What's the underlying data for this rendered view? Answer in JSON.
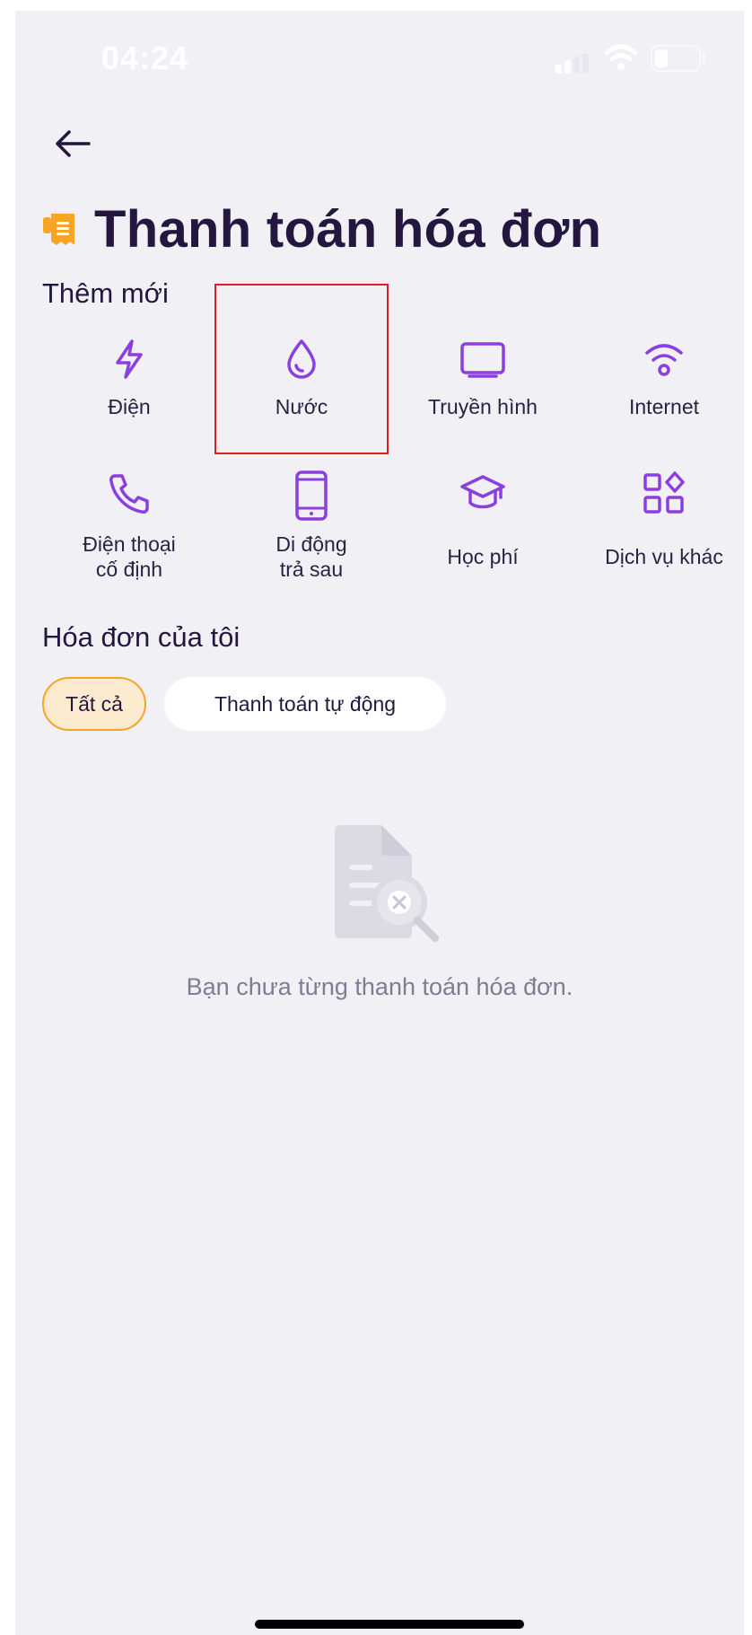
{
  "status_bar": {
    "time": "04:24"
  },
  "header": {
    "title": "Thanh toán hóa đơn",
    "back_icon": "arrow-left-icon"
  },
  "add_new": {
    "section_title": "Thêm mới",
    "services": [
      {
        "label": "Điện",
        "icon": "lightning-icon"
      },
      {
        "label": "Nước",
        "icon": "water-drop-icon"
      },
      {
        "label": "Truyền hình",
        "icon": "tv-icon"
      },
      {
        "label": "Internet",
        "icon": "wifi-icon"
      },
      {
        "label_line1": "Điện thoại",
        "label_line2": "cố định",
        "icon": "phone-icon"
      },
      {
        "label_line1": "Di động",
        "label_line2": "trả sau",
        "icon": "mobile-icon"
      },
      {
        "label": "Học phí",
        "icon": "graduation-cap-icon"
      },
      {
        "label": "Dịch vụ khác",
        "icon": "grid-apps-icon"
      }
    ]
  },
  "my_bills": {
    "section_title": "Hóa đơn của tôi",
    "filters": [
      {
        "label": "Tất cả",
        "active": true
      },
      {
        "label": "Thanh toán tự động",
        "active": false
      }
    ],
    "empty_message": "Bạn chưa từng thanh toán hóa đơn."
  },
  "colors": {
    "accent": "#8b3fe0",
    "title": "#24173f",
    "background": "#f1f0f5",
    "chip_active_border": "#f4a629",
    "chip_active_bg": "#fdebd0",
    "highlight": "#e02020"
  }
}
